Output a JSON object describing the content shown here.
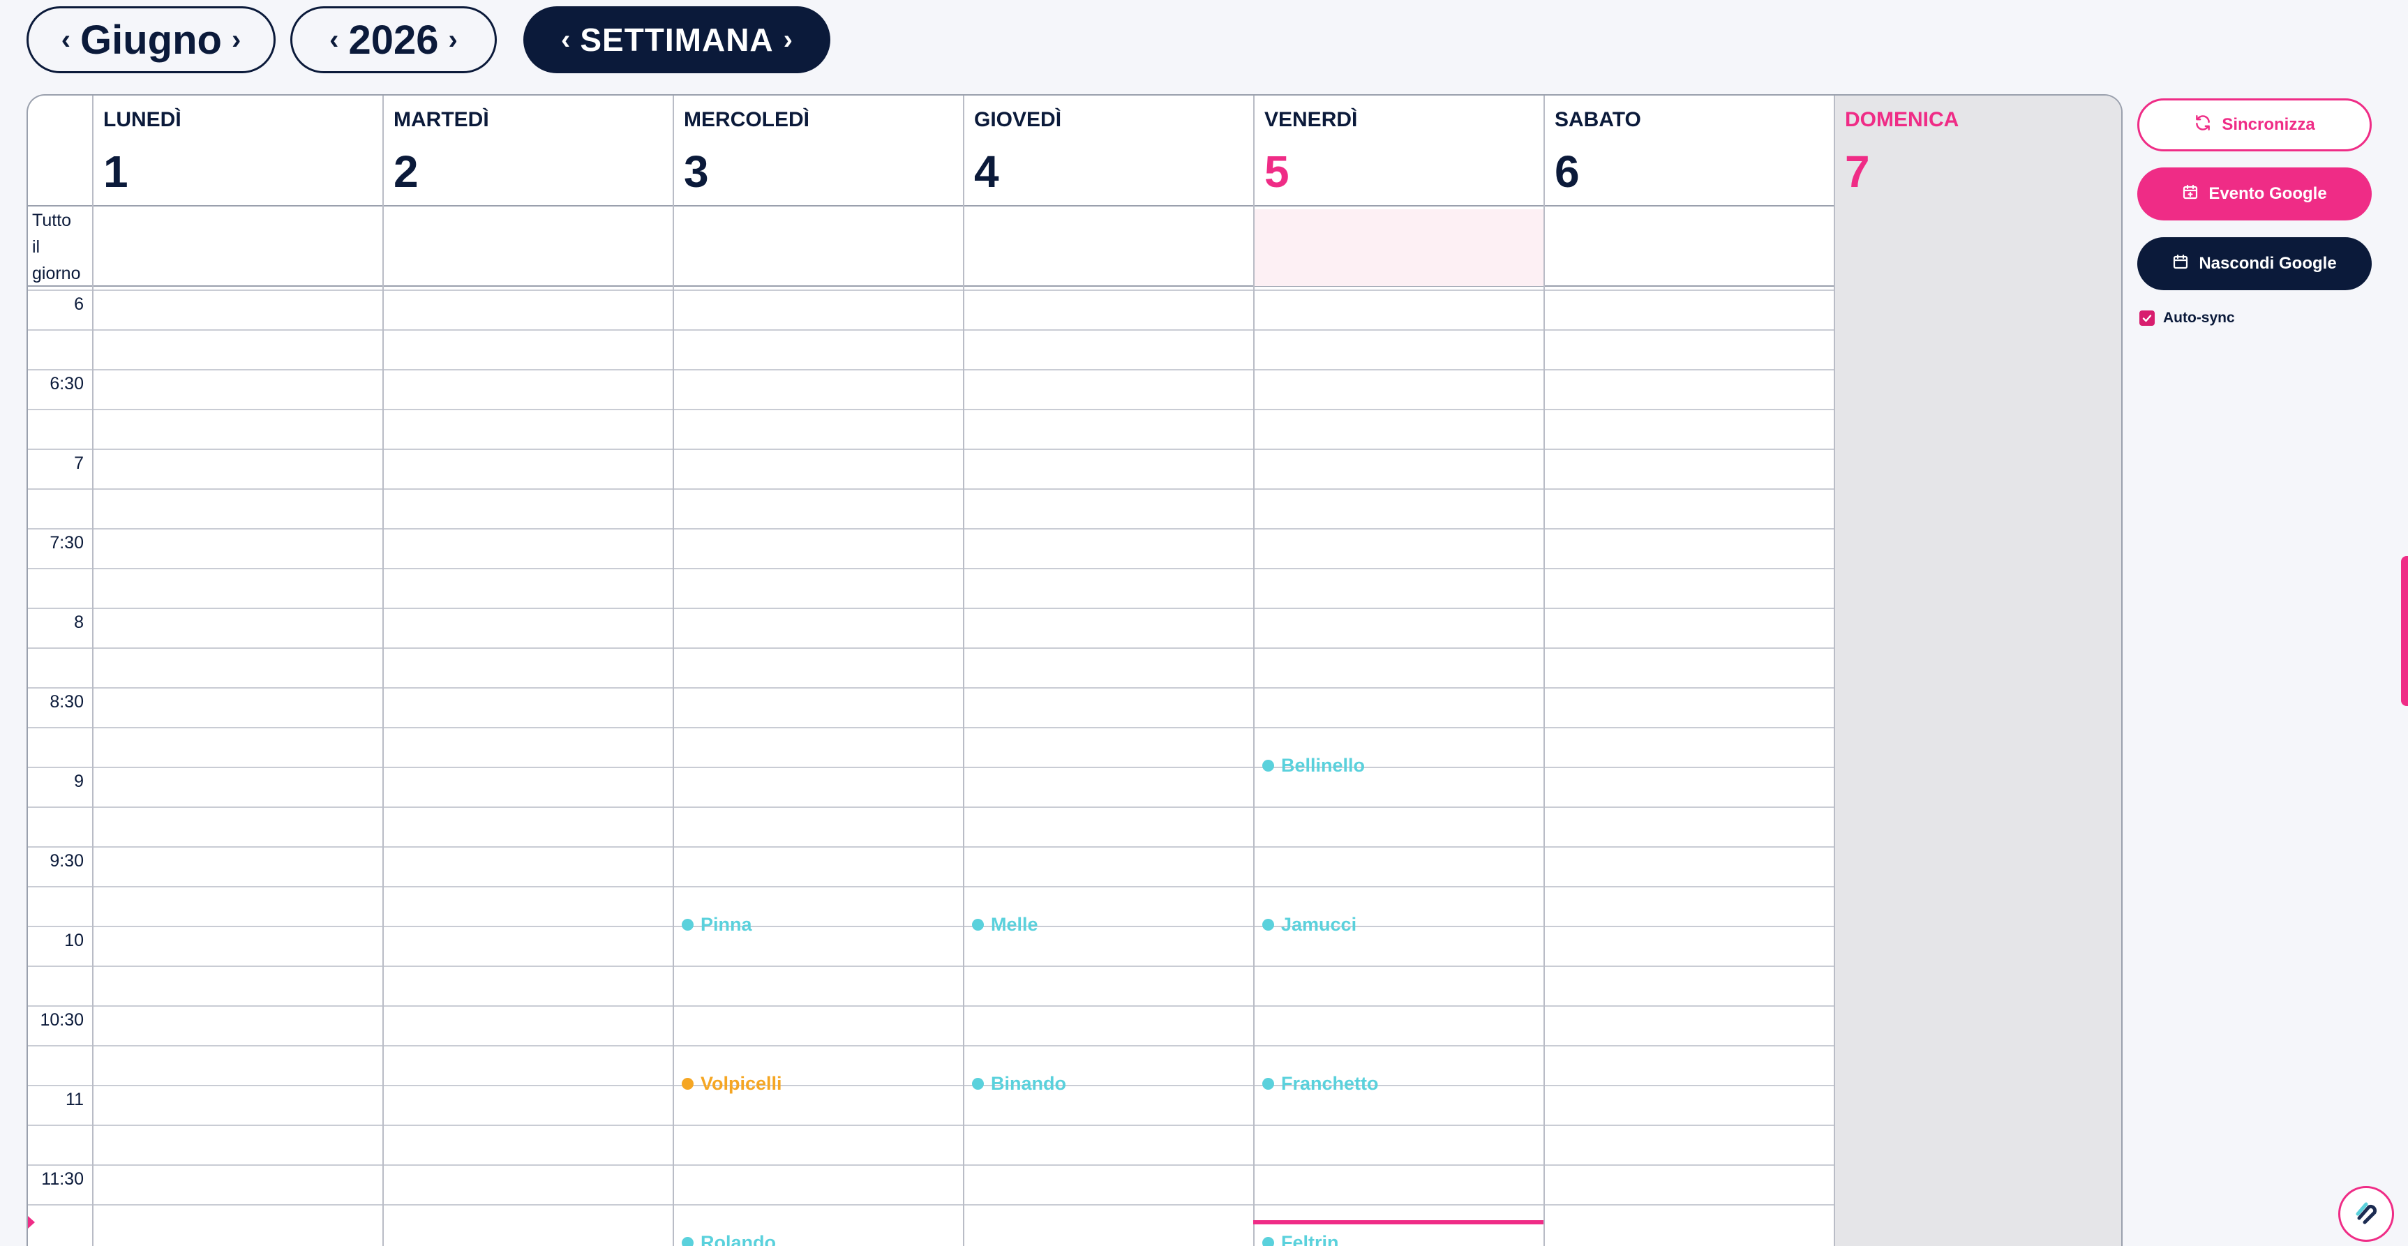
{
  "nav": {
    "month": {
      "label": "Giugno",
      "prev": "‹",
      "next": "›"
    },
    "year": {
      "label": "2026",
      "prev": "‹",
      "next": "›"
    },
    "view": {
      "label": "SETTIMANA",
      "prev": "‹",
      "next": "›"
    }
  },
  "calendar": {
    "allday_label": [
      "Tutto",
      "il",
      "giorno"
    ],
    "days": [
      {
        "name": "LUNEDÌ",
        "number": "1"
      },
      {
        "name": "MARTEDÌ",
        "number": "2"
      },
      {
        "name": "MERCOLEDÌ",
        "number": "3"
      },
      {
        "name": "GIOVEDÌ",
        "number": "4"
      },
      {
        "name": "VENERDÌ",
        "number": "5",
        "today": true
      },
      {
        "name": "SABATO",
        "number": "6"
      },
      {
        "name": "DOMENICA",
        "number": "7",
        "weekend": true
      }
    ],
    "times": [
      "6",
      "6:30",
      "7",
      "7:30",
      "8",
      "8:30",
      "9",
      "9:30",
      "10",
      "10:30",
      "11",
      "11:30"
    ],
    "events": [
      {
        "day": "VENERDÌ",
        "time": "8:45",
        "name": "Bellinello",
        "color": "#5ad1dc"
      },
      {
        "day": "MERCOLEDÌ",
        "time": "9:45",
        "name": "Pinna",
        "color": "#5ad1dc"
      },
      {
        "day": "GIOVEDÌ",
        "time": "9:45",
        "name": "Melle",
        "color": "#5ad1dc"
      },
      {
        "day": "VENERDÌ",
        "time": "9:45",
        "name": "Jamucci",
        "color": "#5ad1dc"
      },
      {
        "day": "MERCOLEDÌ",
        "time": "10:45",
        "name": "Volpicelli",
        "color": "#f5a623"
      },
      {
        "day": "GIOVEDÌ",
        "time": "10:45",
        "name": "Binando",
        "color": "#5ad1dc"
      },
      {
        "day": "VENERDÌ",
        "time": "10:45",
        "name": "Franchetto",
        "color": "#5ad1dc"
      },
      {
        "day": "MERCOLEDÌ",
        "time": "11:45",
        "name": "Rolando",
        "color": "#5ad1dc"
      },
      {
        "day": "VENERDÌ",
        "time": "11:45",
        "name": "Feltrin",
        "color": "#5ad1dc"
      }
    ]
  },
  "sidebar": {
    "sync_label": "Sincronizza",
    "google_event_label": "Evento Google",
    "hide_google_label": "Nascondi Google",
    "autosync_label": "Auto-sync",
    "autosync_checked": true
  },
  "colors": {
    "navy": "#0b1a3a",
    "pink": "#ef2c86",
    "event_cyan": "#5ad1dc",
    "event_orange": "#f5a623",
    "sunday_bg": "#e5e5e8"
  }
}
